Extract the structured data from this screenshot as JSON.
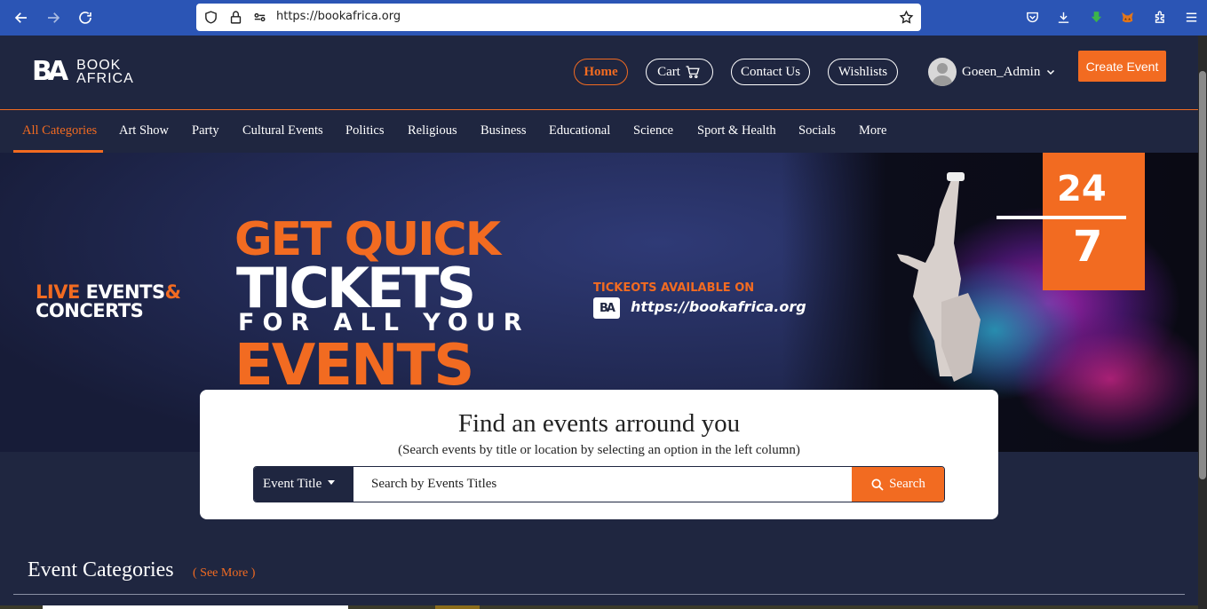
{
  "browser": {
    "url": "https://bookafrica.org"
  },
  "header": {
    "logo_mark": "BA",
    "logo_line1": "BOOK",
    "logo_line2": "AFRICA",
    "nav": {
      "home": "Home",
      "cart": "Cart",
      "contact": "Contact Us",
      "wishlists": "Wishlists"
    },
    "username": "Goeen_Admin",
    "create_event": "Create Event"
  },
  "categories": [
    "All Categories",
    "Art Show",
    "Party",
    "Cultural Events",
    "Politics",
    "Religious",
    "Business",
    "Educational",
    "Science",
    "Sport & Health",
    "Socials",
    "More"
  ],
  "hero": {
    "live_1": "LIVE",
    "live_2": "EVENTS",
    "live_amp": "&",
    "live_3": "CONCERTS",
    "line1": "GET QUICK",
    "line2": "TICKETS",
    "line3": "FOR ALL YOUR",
    "line4": "EVENTS",
    "available": "TICKEOTS AVAILABLE ON",
    "small_logo": "BA",
    "url": "https://bookafrica.org",
    "badge_top": "24",
    "badge_bottom": "7"
  },
  "search": {
    "title": "Find an events arround you",
    "subtitle": "(Search events by title or location by selecting an option in the left column)",
    "select_value": "Event Title",
    "placeholder": "Search by Events Titles",
    "button": "Search"
  },
  "event_categories": {
    "title": "Event Categories",
    "see_more": "( See More )"
  },
  "colors": {
    "accent": "#f26b21",
    "navy": "#1f2640",
    "browser": "#2b55b5"
  }
}
